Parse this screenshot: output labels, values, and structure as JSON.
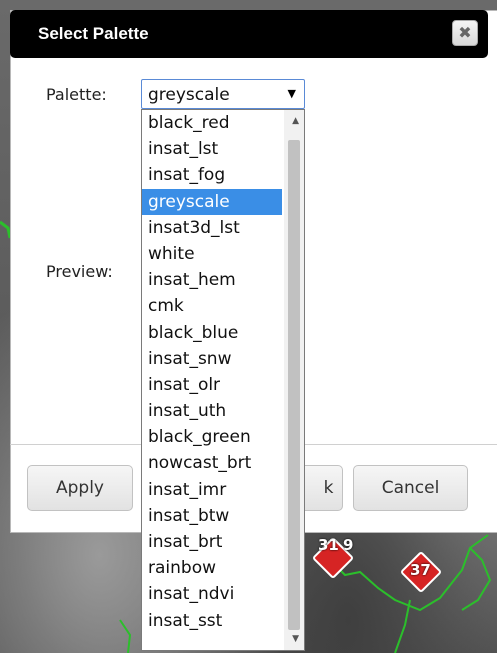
{
  "dialog": {
    "title": "Select Palette",
    "close_glyph": "✖",
    "palette_label": "Palette:",
    "preview_label": "Preview:",
    "selected_palette": "greyscale",
    "apply_label": "Apply",
    "ok_label": "Ok",
    "cancel_label": "Cancel",
    "ok_visible_fragment": "k"
  },
  "dropdown": {
    "options": [
      "black_red",
      "insat_lst",
      "insat_fog",
      "greyscale",
      "insat3d_lst",
      "white",
      "insat_hem",
      "cmk",
      "black_blue",
      "insat_snw",
      "insat_olr",
      "insat_uth",
      "black_green",
      "nowcast_brt",
      "insat_imr",
      "insat_btw",
      "insat_brt",
      "rainbow",
      "insat_ndvi",
      "insat_sst"
    ],
    "selected_index": 3
  },
  "map": {
    "markers": [
      {
        "label": "31",
        "label_suffix": "9"
      },
      {
        "label": "37"
      }
    ],
    "colors": {
      "coastline": "#2bbf2b",
      "marker": "#d62424"
    }
  }
}
